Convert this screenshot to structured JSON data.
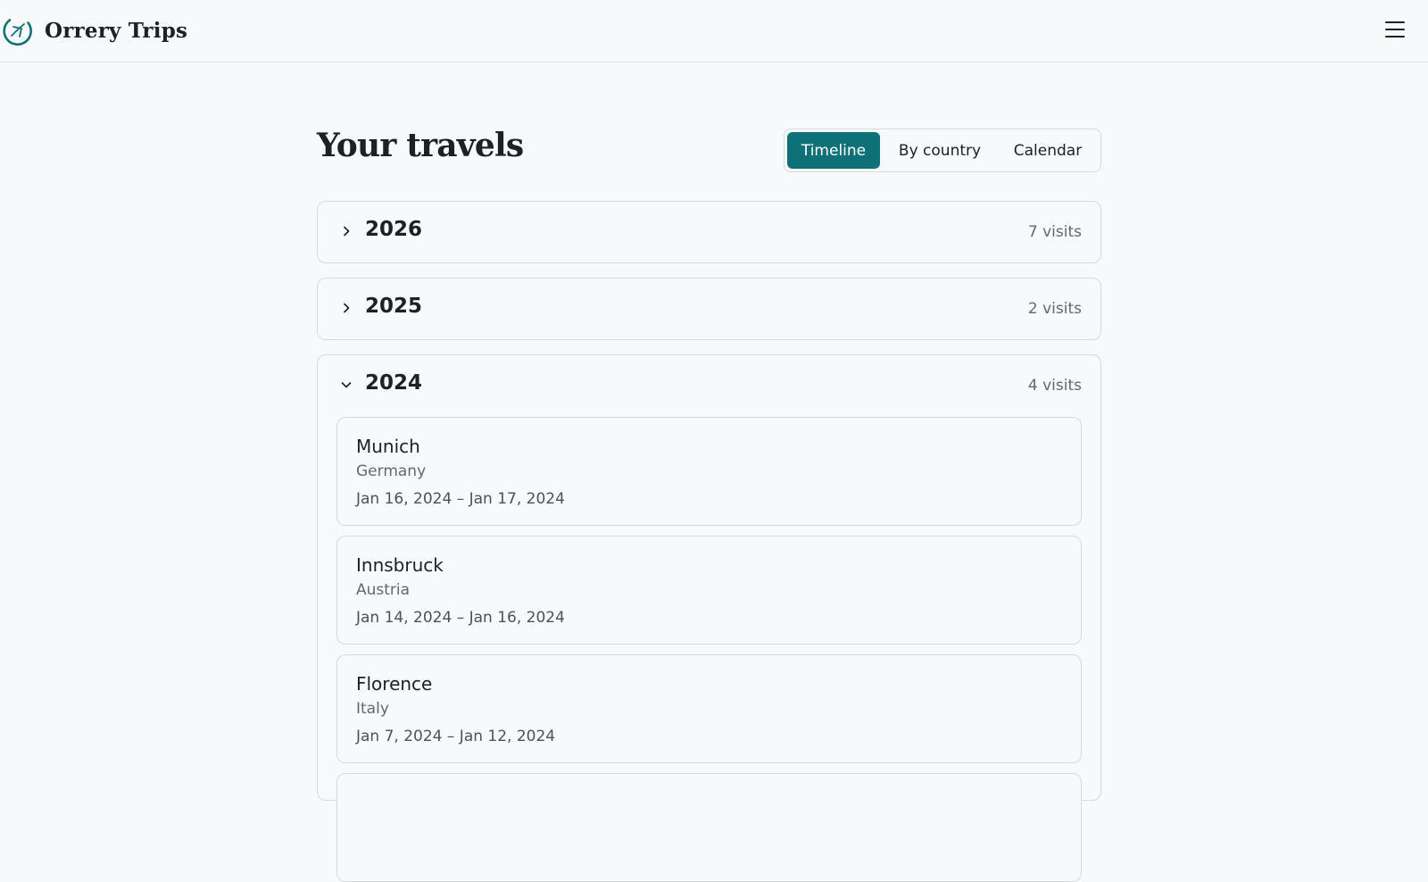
{
  "brand": {
    "name": "Orrery Trips",
    "logo_icon": "globe-plane-icon",
    "accent_color": "#0e7178"
  },
  "header": {
    "menu_icon": "hamburger-menu-icon"
  },
  "page": {
    "title": "Your travels"
  },
  "view_toggle": {
    "options": [
      "Timeline",
      "By country",
      "Calendar"
    ],
    "selected": "Timeline"
  },
  "years": [
    {
      "year": "2026",
      "visits": "7 visits",
      "expanded": false
    },
    {
      "year": "2025",
      "visits": "2 visits",
      "expanded": false
    },
    {
      "year": "2024",
      "visits": "4 visits",
      "expanded": true,
      "trips": [
        {
          "city": "Munich",
          "country": "Germany",
          "dates": "Jan 16, 2024 – Jan 17, 2024"
        },
        {
          "city": "Innsbruck",
          "country": "Austria",
          "dates": "Jan 14, 2024 – Jan 16, 2024"
        },
        {
          "city": "Florence",
          "country": "Italy",
          "dates": "Jan 7, 2024 – Jan 12, 2024"
        }
      ]
    }
  ]
}
